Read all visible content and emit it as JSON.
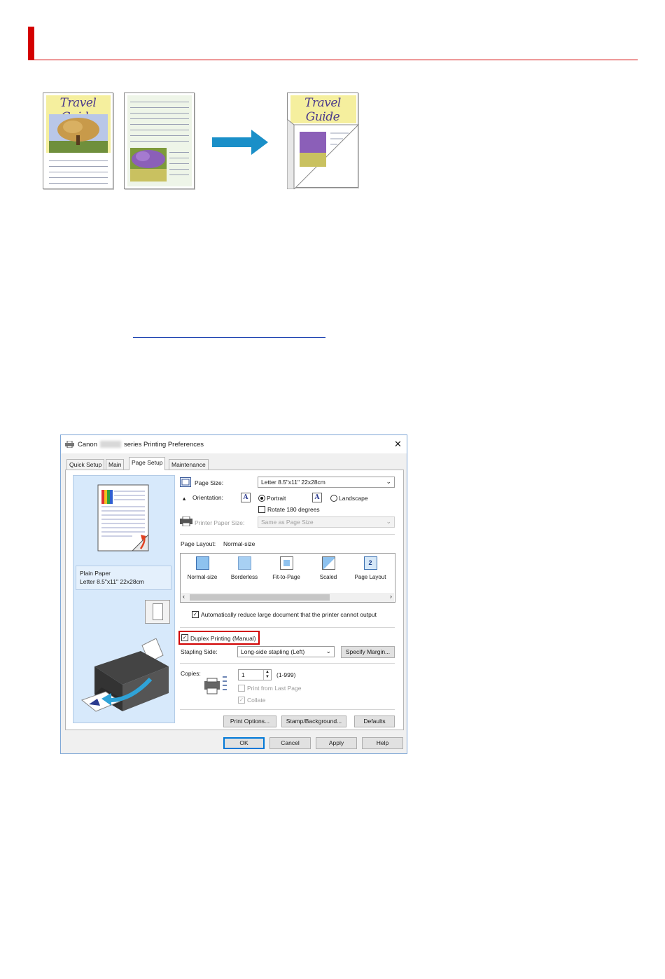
{
  "illustration": {
    "guide_title": "Travel Guide"
  },
  "link_text": "",
  "dialog": {
    "title_prefix": "Canon",
    "title_suffix": "series Printing Preferences",
    "close_glyph": "✕",
    "tabs": [
      "Quick Setup",
      "Main",
      "Page Setup",
      "Maintenance"
    ],
    "active_tab": "Page Setup",
    "preview": {
      "media_type": "Plain Paper",
      "paper_size": "Letter 8.5\"x11\" 22x28cm"
    },
    "page_size": {
      "label": "Page Size:",
      "value": "Letter 8.5\"x11\" 22x28cm"
    },
    "orientation": {
      "label": "Orientation:",
      "options": [
        "Portrait",
        "Landscape"
      ],
      "selected": "Portrait",
      "rotate_label": "Rotate 180 degrees"
    },
    "printer_paper_size": {
      "label": "Printer Paper Size:",
      "value": "Same as Page Size"
    },
    "page_layout": {
      "label": "Page Layout:",
      "current": "Normal-size",
      "items": [
        "Normal-size",
        "Borderless",
        "Fit-to-Page",
        "Scaled",
        "Page Layout"
      ]
    },
    "auto_reduce_label": "Automatically reduce large document that the printer cannot output",
    "duplex_label": "Duplex Printing (Manual)",
    "stapling": {
      "label": "Stapling Side:",
      "value": "Long-side stapling (Left)",
      "margin_button": "Specify Margin..."
    },
    "copies": {
      "label": "Copies:",
      "value": "1",
      "range": "(1-999)",
      "print_from_last_label": "Print from Last Page",
      "collate_label": "Collate"
    },
    "footer_buttons": {
      "print_options": "Print Options...",
      "stamp": "Stamp/Background...",
      "defaults": "Defaults"
    },
    "bottom_buttons": {
      "ok": "OK",
      "cancel": "Cancel",
      "apply": "Apply",
      "help": "Help"
    }
  },
  "colors": {
    "accent_red": "#d40000",
    "arrow_blue": "#1a8fc8",
    "link_blue": "#1a40b0",
    "dialog_border": "#7fa7d6"
  }
}
